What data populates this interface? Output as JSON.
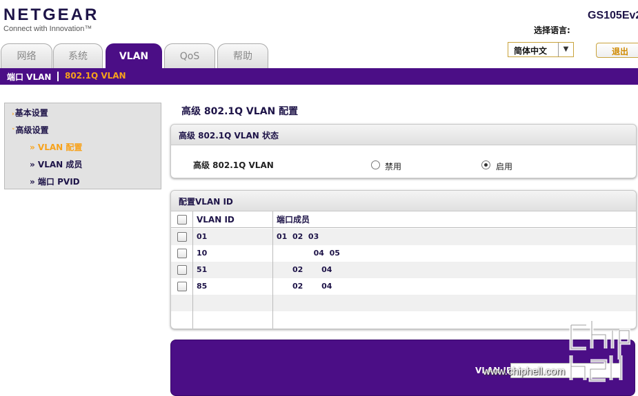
{
  "brand": {
    "logo": "NETGEAR",
    "tagline": "Connect with Innovation™"
  },
  "header": {
    "model": "GS105Ev2",
    "language_label": "选择语言:",
    "language_value": "简体中文",
    "logout_label": "退出"
  },
  "tabs": [
    {
      "label": "网络",
      "active": false
    },
    {
      "label": "系统",
      "active": false
    },
    {
      "label": "VLAN",
      "active": true
    },
    {
      "label": "QoS",
      "active": false
    },
    {
      "label": "帮助",
      "active": false
    }
  ],
  "subnav": [
    {
      "label": "端口 VLAN",
      "active": false
    },
    {
      "label": "802.1Q VLAN",
      "active": true
    }
  ],
  "sidebar": {
    "items": [
      {
        "label": "基本设置"
      },
      {
        "label": "高级设置"
      },
      {
        "label": "» VLAN 配置"
      },
      {
        "label": "» VLAN 成员"
      },
      {
        "label": "» 端口 PVID"
      }
    ]
  },
  "main": {
    "title": "高级 802.1Q VLAN 配置",
    "status_panel": {
      "header": "高级 802.1Q VLAN 状态",
      "label": "高级 802.1Q VLAN",
      "options": [
        {
          "label": "禁用",
          "checked": false
        },
        {
          "label": "启用",
          "checked": true
        }
      ]
    },
    "config_panel": {
      "header": "配置VLAN ID",
      "columns": [
        "VLAN ID",
        "端口成员"
      ],
      "rows": [
        {
          "vlan_id": "01",
          "members": "01  02  03"
        },
        {
          "vlan_id": "10",
          "members": "              04  05"
        },
        {
          "vlan_id": "51",
          "members": "      02       04"
        },
        {
          "vlan_id": "85",
          "members": "      02       04"
        }
      ]
    },
    "bottom": {
      "vlan_id_label": "VLAN ID"
    }
  },
  "watermark": {
    "text": "www.chiphell.com"
  },
  "colors": {
    "brand_purple": "#4b0e86",
    "accent_orange": "#f7a21b",
    "navy_text": "#1e1448"
  }
}
